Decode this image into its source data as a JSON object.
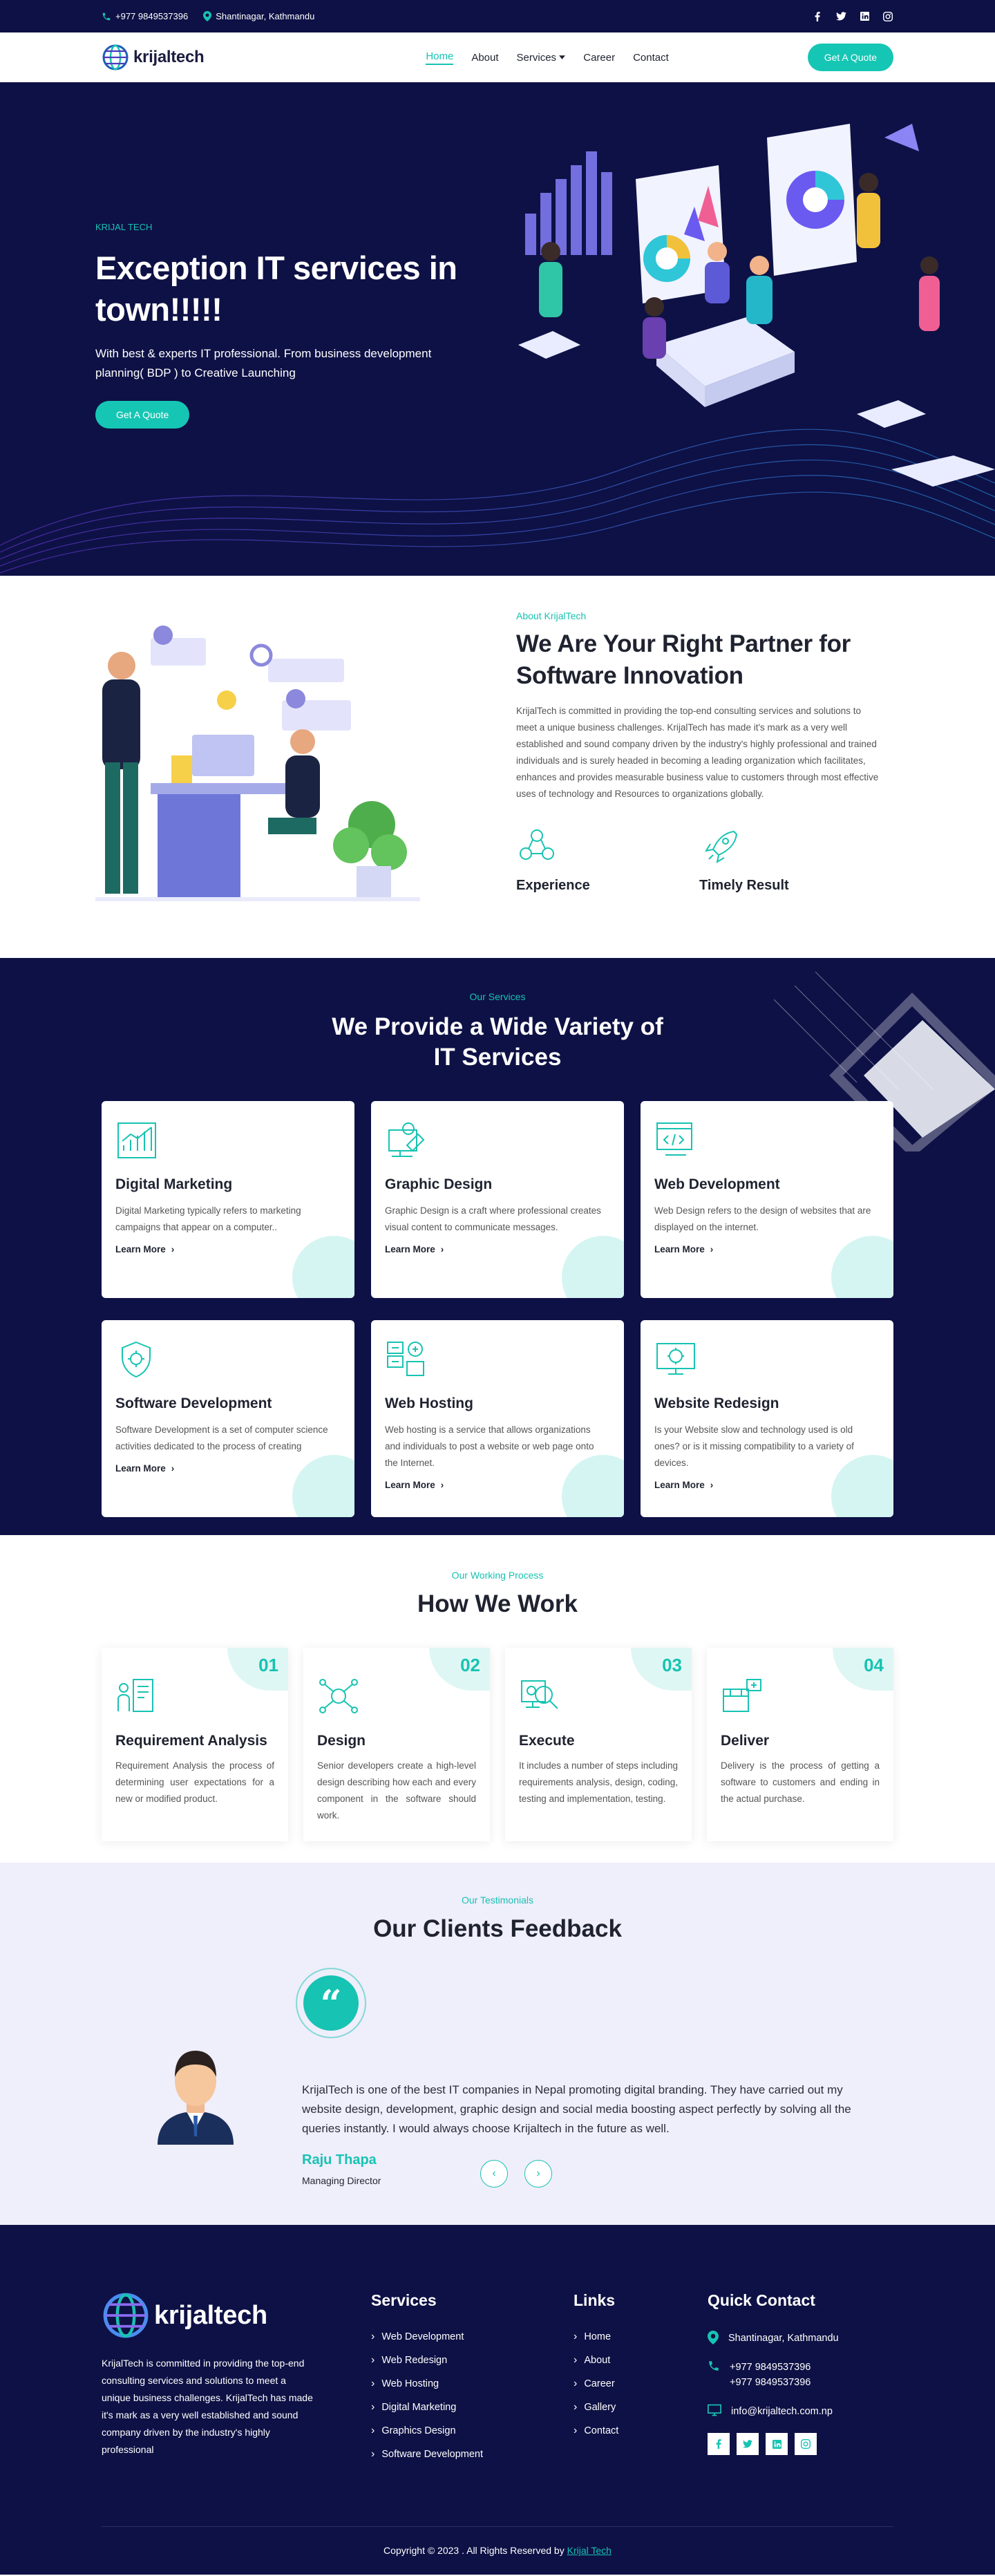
{
  "topbar": {
    "phone": "+977 9849537396",
    "location": "Shantinagar, Kathmandu",
    "social": [
      "facebook-icon",
      "twitter-icon",
      "linkedin-icon",
      "instagram-icon"
    ]
  },
  "nav": {
    "logo": "krijaltech",
    "items": [
      "Home",
      "About",
      "Services",
      "Career",
      "Contact"
    ],
    "active": "Home",
    "cta": "Get A Quote"
  },
  "hero": {
    "eyebrow": "KRIJAL TECH",
    "title": "Exception IT services in town!!!!!",
    "subtitle": "With best & experts IT professional. From business development planning( BDP ) to Creative Launching",
    "cta": "Get A Quote"
  },
  "about": {
    "eyebrow": "About KrijalTech",
    "title": "We Are Your Right Partner for Software Innovation",
    "body": "KrijalTech is committed in providing the top-end consulting services and solutions to meet a unique business challenges. KrijalTech has made it's mark as a very well established and sound company driven by the industry's highly professional and trained individuals and is surely headed in becoming a leading organization which facilitates, enhances and provides measurable business value to customers through most effective uses of technology and Resources to organizations globally.",
    "features": [
      "Experience",
      "Timely Result"
    ]
  },
  "services": {
    "eyebrow": "Our Services",
    "title_line1": "We Provide a Wide Variety of",
    "title_line2": "IT Services",
    "more_label": "Learn More",
    "cards": [
      {
        "title": "Digital Marketing",
        "text": "Digital Marketing typically refers to marketing campaigns that appear on a computer..",
        "icon": "chart-icon"
      },
      {
        "title": "Graphic Design",
        "text": "Graphic Design is a craft where professional creates visual content to communicate messages.",
        "icon": "design-icon"
      },
      {
        "title": "Web Development",
        "text": "Web Design refers to the design of websites that are displayed on the internet.",
        "icon": "code-icon"
      },
      {
        "title": "Software Development",
        "text": "Software Development is a set of computer science activities dedicated to the process of creating",
        "icon": "shield-gear-icon"
      },
      {
        "title": "Web Hosting",
        "text": "Web hosting is a service that allows organizations and individuals to post a website or web page onto the Internet.",
        "icon": "server-icon"
      },
      {
        "title": "Website Redesign",
        "text": "Is your Website slow and technology used is old ones? or is it missing compatibility to a variety of devices.",
        "icon": "monitor-gear-icon"
      }
    ]
  },
  "process": {
    "eyebrow": "Our Working Process",
    "title": "How We Work",
    "steps": [
      {
        "num": "01",
        "title": "Requirement Analysis",
        "text": "Requirement Analysis the process of determining user expectations for a new or modified product."
      },
      {
        "num": "02",
        "title": "Design",
        "text": "Senior developers create a high-level design describing how each and every component in the software should work."
      },
      {
        "num": "03",
        "title": "Execute",
        "text": "It includes a number of steps including requirements analysis, design, coding, testing and implementation, testing."
      },
      {
        "num": "04",
        "title": "Deliver",
        "text": "Delivery is the process of getting a software to customers and ending in the actual purchase."
      }
    ]
  },
  "testimonials": {
    "eyebrow": "Our Testimonials",
    "title": "Our Clients Feedback",
    "quote": "KrijalTech is one of the best IT companies in Nepal promoting digital branding. They have carried out my website design, development, graphic design and social media boosting aspect perfectly by solving all the queries instantly. I would always choose Krijaltech in the future as well.",
    "name": "Raju Thapa",
    "role": "Managing Director"
  },
  "footer": {
    "logo": "krijaltech",
    "description": "KrijalTech is committed in providing the top-end consulting services and solutions to meet a unique business challenges. KrijalTech has made it's mark as a very well established and sound company driven by the industry's highly professional",
    "services_title": "Services",
    "services": [
      "Web Development",
      "Web Redesign",
      "Web Hosting",
      "Digital Marketing",
      "Graphics Design",
      "Software Development"
    ],
    "links_title": "Links",
    "links": [
      "Home",
      "About",
      "Career",
      "Gallery",
      "Contact"
    ],
    "contact_title": "Quick Contact",
    "address": "Shantinagar, Kathmandu",
    "phone1": "+977 9849537396",
    "phone2": "+977 9849537396",
    "email": "info@krijaltech.com.np",
    "copyright": "Copyright © 2023 . All Rights Reserved by",
    "copyright_link": "Krijal Tech"
  },
  "colors": {
    "accent": "#16c6b4",
    "navy": "#0e1145",
    "lavender": "#efeefb"
  }
}
